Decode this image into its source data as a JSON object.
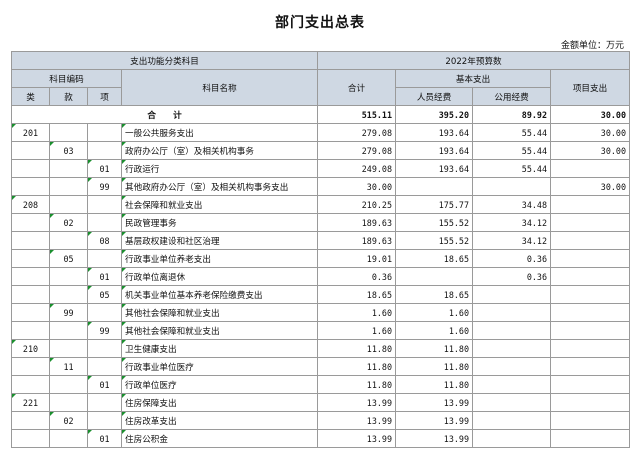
{
  "title": "部门支出总表",
  "unit": "金额单位：万元",
  "header": {
    "func_class": "支出功能分类科目",
    "budget_year": "2022年预算数",
    "subject_code": "科目编码",
    "subject_name": "科目名称",
    "total": "合计",
    "basic": "基本支出",
    "project": "项目支出",
    "personnel": "人员经费",
    "public": "公用经费",
    "lei": "类",
    "kuan": "款",
    "xiang": "项"
  },
  "total_row": {
    "label": "合　　计",
    "total": "515.11",
    "personnel": "395.20",
    "public": "89.92",
    "project": "30.00"
  },
  "rows": [
    {
      "lei": "201",
      "kuan": "",
      "xiang": "",
      "name": "一般公共服务支出",
      "total": "279.08",
      "personnel": "193.64",
      "public": "55.44",
      "project": "30.00"
    },
    {
      "lei": "",
      "kuan": "03",
      "xiang": "",
      "name": "政府办公厅（室）及相关机构事务",
      "total": "279.08",
      "personnel": "193.64",
      "public": "55.44",
      "project": "30.00"
    },
    {
      "lei": "",
      "kuan": "",
      "xiang": "01",
      "name": "行政运行",
      "total": "249.08",
      "personnel": "193.64",
      "public": "55.44",
      "project": ""
    },
    {
      "lei": "",
      "kuan": "",
      "xiang": "99",
      "name": "其他政府办公厅（室）及相关机构事务支出",
      "total": "30.00",
      "personnel": "",
      "public": "",
      "project": "30.00"
    },
    {
      "lei": "208",
      "kuan": "",
      "xiang": "",
      "name": "社会保障和就业支出",
      "total": "210.25",
      "personnel": "175.77",
      "public": "34.48",
      "project": ""
    },
    {
      "lei": "",
      "kuan": "02",
      "xiang": "",
      "name": "民政管理事务",
      "total": "189.63",
      "personnel": "155.52",
      "public": "34.12",
      "project": ""
    },
    {
      "lei": "",
      "kuan": "",
      "xiang": "08",
      "name": "基层政权建设和社区治理",
      "total": "189.63",
      "personnel": "155.52",
      "public": "34.12",
      "project": ""
    },
    {
      "lei": "",
      "kuan": "05",
      "xiang": "",
      "name": "行政事业单位养老支出",
      "total": "19.01",
      "personnel": "18.65",
      "public": "0.36",
      "project": ""
    },
    {
      "lei": "",
      "kuan": "",
      "xiang": "01",
      "name": "行政单位离退休",
      "total": "0.36",
      "personnel": "",
      "public": "0.36",
      "project": ""
    },
    {
      "lei": "",
      "kuan": "",
      "xiang": "05",
      "name": "机关事业单位基本养老保险缴费支出",
      "total": "18.65",
      "personnel": "18.65",
      "public": "",
      "project": ""
    },
    {
      "lei": "",
      "kuan": "99",
      "xiang": "",
      "name": "其他社会保障和就业支出",
      "total": "1.60",
      "personnel": "1.60",
      "public": "",
      "project": ""
    },
    {
      "lei": "",
      "kuan": "",
      "xiang": "99",
      "name": "其他社会保障和就业支出",
      "total": "1.60",
      "personnel": "1.60",
      "public": "",
      "project": ""
    },
    {
      "lei": "210",
      "kuan": "",
      "xiang": "",
      "name": "卫生健康支出",
      "total": "11.80",
      "personnel": "11.80",
      "public": "",
      "project": ""
    },
    {
      "lei": "",
      "kuan": "11",
      "xiang": "",
      "name": "行政事业单位医疗",
      "total": "11.80",
      "personnel": "11.80",
      "public": "",
      "project": ""
    },
    {
      "lei": "",
      "kuan": "",
      "xiang": "01",
      "name": "行政单位医疗",
      "total": "11.80",
      "personnel": "11.80",
      "public": "",
      "project": ""
    },
    {
      "lei": "221",
      "kuan": "",
      "xiang": "",
      "name": "住房保障支出",
      "total": "13.99",
      "personnel": "13.99",
      "public": "",
      "project": ""
    },
    {
      "lei": "",
      "kuan": "02",
      "xiang": "",
      "name": "住房改革支出",
      "total": "13.99",
      "personnel": "13.99",
      "public": "",
      "project": ""
    },
    {
      "lei": "",
      "kuan": "",
      "xiang": "01",
      "name": "住房公积金",
      "total": "13.99",
      "personnel": "13.99",
      "public": "",
      "project": ""
    }
  ]
}
